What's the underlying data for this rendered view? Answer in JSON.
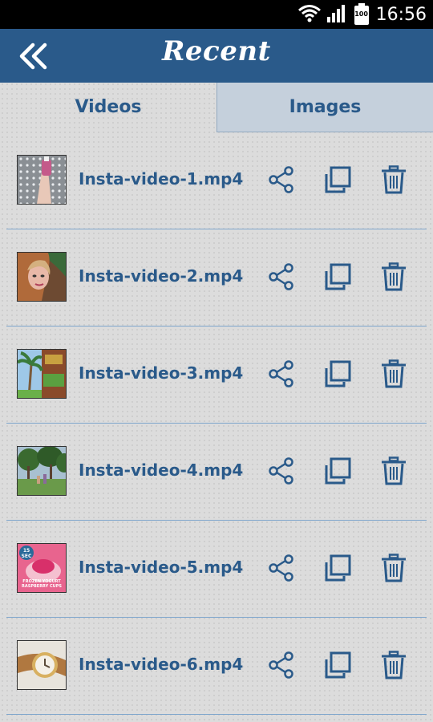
{
  "status_bar": {
    "time": "16:56",
    "battery": "100"
  },
  "header": {
    "title": "Recent"
  },
  "tabs": [
    {
      "label": "Videos",
      "selected": true
    },
    {
      "label": "Images",
      "selected": false
    }
  ],
  "files": [
    {
      "name": "Insta-video-1.mp4"
    },
    {
      "name": "Insta-video-2.mp4"
    },
    {
      "name": "Insta-video-3.mp4"
    },
    {
      "name": "Insta-video-4.mp4"
    },
    {
      "name": "Insta-video-5.mp4",
      "thumb_badge": "15 SEC",
      "thumb_caption": "FROZEN YOGURT RASPBERRY CUPS"
    },
    {
      "name": "Insta-video-6.mp4"
    }
  ],
  "colors": {
    "primary": "#2a5a8a",
    "tab_inactive_bg": "#c5d0dc",
    "divider": "#7fa6cc"
  },
  "icons": {
    "back": "double-chevron-left-icon",
    "share": "share-icon",
    "copy": "copy-icon",
    "delete": "trash-icon"
  }
}
